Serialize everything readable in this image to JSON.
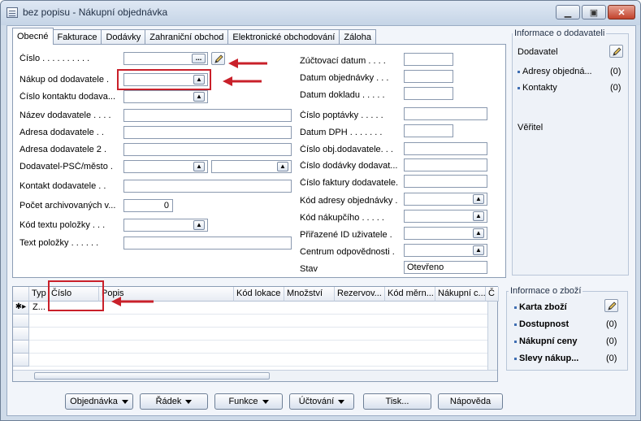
{
  "window": {
    "title": "bez popisu - Nákupní objednávka",
    "minimize": "▁",
    "restore": "▣",
    "close": "✕"
  },
  "tabs": [
    "Obecné",
    "Fakturace",
    "Dodávky",
    "Zahraniční obchod",
    "Elektronické obchodování",
    "Záloha"
  ],
  "left_fields": {
    "cislo": "Číslo . . . . . . . . . .",
    "nakup_od_dodavatele": "Nákup od dodavatele  .",
    "cislo_kontaktu": "Číslo kontaktu dodava...",
    "nazev_dodavatele": "Název dodavatele . . . .",
    "adresa_dodavatele": "Adresa dodavatele  . .",
    "adresa_dodavatele_2": "Adresa dodavatele 2  .",
    "dodavatel_psc": "Dodavatel-PSČ/město  .",
    "kontakt_dodavatele": "Kontakt dodavatele  . .",
    "pocet_archivovanych": "Počet archivovaných v...",
    "pocet_archivovanych_value": "0",
    "kod_textu_polozky": "Kód textu položky  . . .",
    "text_polozky": "Text položky  . . . . . ."
  },
  "right_fields": {
    "zuctovaci_datum": "Zúčtovací datum  . . . .",
    "datum_objednavky": "Datum objednávky  . . .",
    "datum_dokladu": "Datum dokladu  . . . . .",
    "cislo_poptavky": "Číslo poptávky  . . . . .",
    "datum_dph": "Datum DPH  . . . . . . .",
    "cislo_obj_dodavatele": "Číslo obj.dodavatele. . .",
    "cislo_dodavky": "Číslo dodávky dodavat...",
    "cislo_faktury": "Číslo faktury dodavatele.",
    "kod_adresy": "Kód adresy objednávky  .",
    "kod_nakupciho": "Kód nákupčího  . . . . .",
    "prirazene_id": "Přiřazené ID uživatele  .",
    "centrum": "Centrum odpovědnosti  .",
    "stav": "Stav",
    "stav_value": "Otevřeno"
  },
  "vendor_panel": {
    "title": "Informace o dodavateli",
    "dodavatel": "Dodavatel",
    "adresy": "Adresy objedná...",
    "adresy_count": "(0)",
    "kontakty": "Kontakty",
    "kontakty_count": "(0)",
    "veritel": "Věřitel"
  },
  "item_panel": {
    "title": "Informace o zboží",
    "karta": "Karta zboží",
    "dostupnost": "Dostupnost",
    "dostupnost_count": "(0)",
    "nakupni_ceny": "Nákupní ceny",
    "nakupni_ceny_count": "(0)",
    "slevy": "Slevy nákup...",
    "slevy_count": "(0)"
  },
  "grid": {
    "columns": [
      "Typ",
      "Číslo",
      "Popis",
      "Kód lokace",
      "Množství",
      "Rezervov...",
      "Kód měrn...",
      "Nákupní c...",
      "Č"
    ],
    "first_row_type": "Z...",
    "new_row_marker": "✱▸"
  },
  "buttons": {
    "objednavka": "Objednávka",
    "radek": "Řádek",
    "funkce": "Funkce",
    "uctovani": "Účtování",
    "tisk": "Tisk...",
    "napoveda": "Nápověda"
  },
  "icons": {
    "lookup": "▲",
    "dots": "...",
    "pencil": "pencil-icon"
  },
  "colors": {
    "annotation_red": "#c9202a",
    "window_frame": "#cfdbe9"
  }
}
